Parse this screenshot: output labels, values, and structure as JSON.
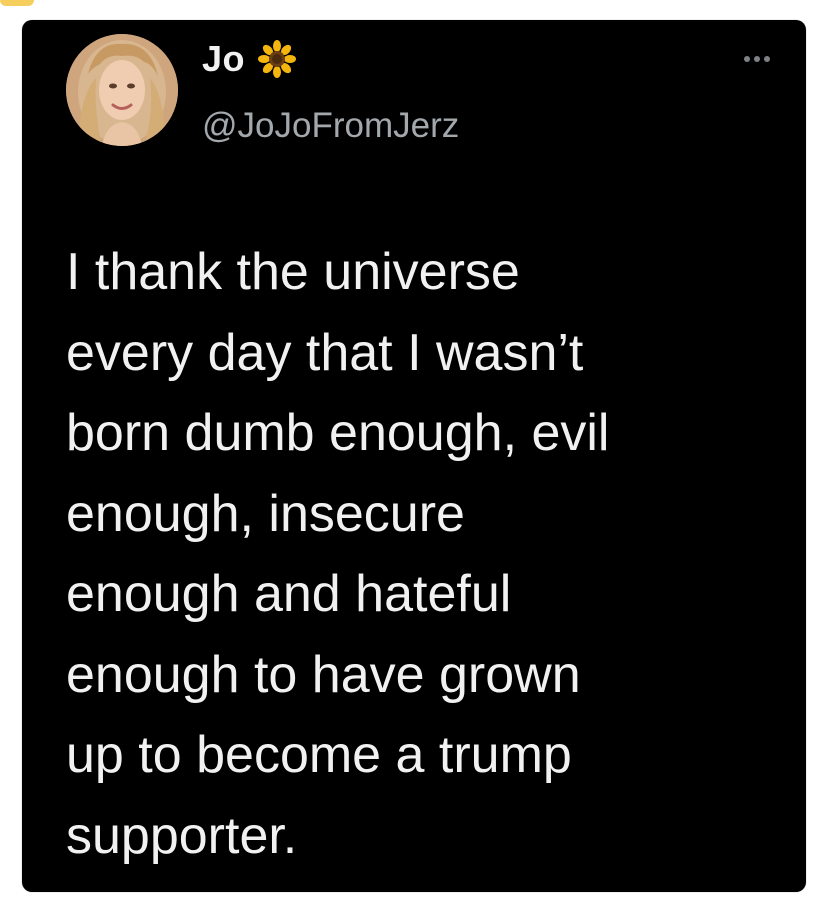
{
  "tweet": {
    "display_name": "Jo",
    "handle": "@JoJoFromJerz",
    "text": "I thank the universe\nevery day that I wasn’t\nborn dumb enough, evil\nenough, insecure\nenough and hateful\nenough to have grown\nup to become a trump\nsupporter."
  },
  "icons": {
    "name_emoji": "sunflower-icon",
    "menu": "more-options-icon"
  },
  "colors": {
    "card_background": "#000000",
    "text_primary": "#f1f1f1",
    "text_secondary": "#a3a8ad"
  }
}
